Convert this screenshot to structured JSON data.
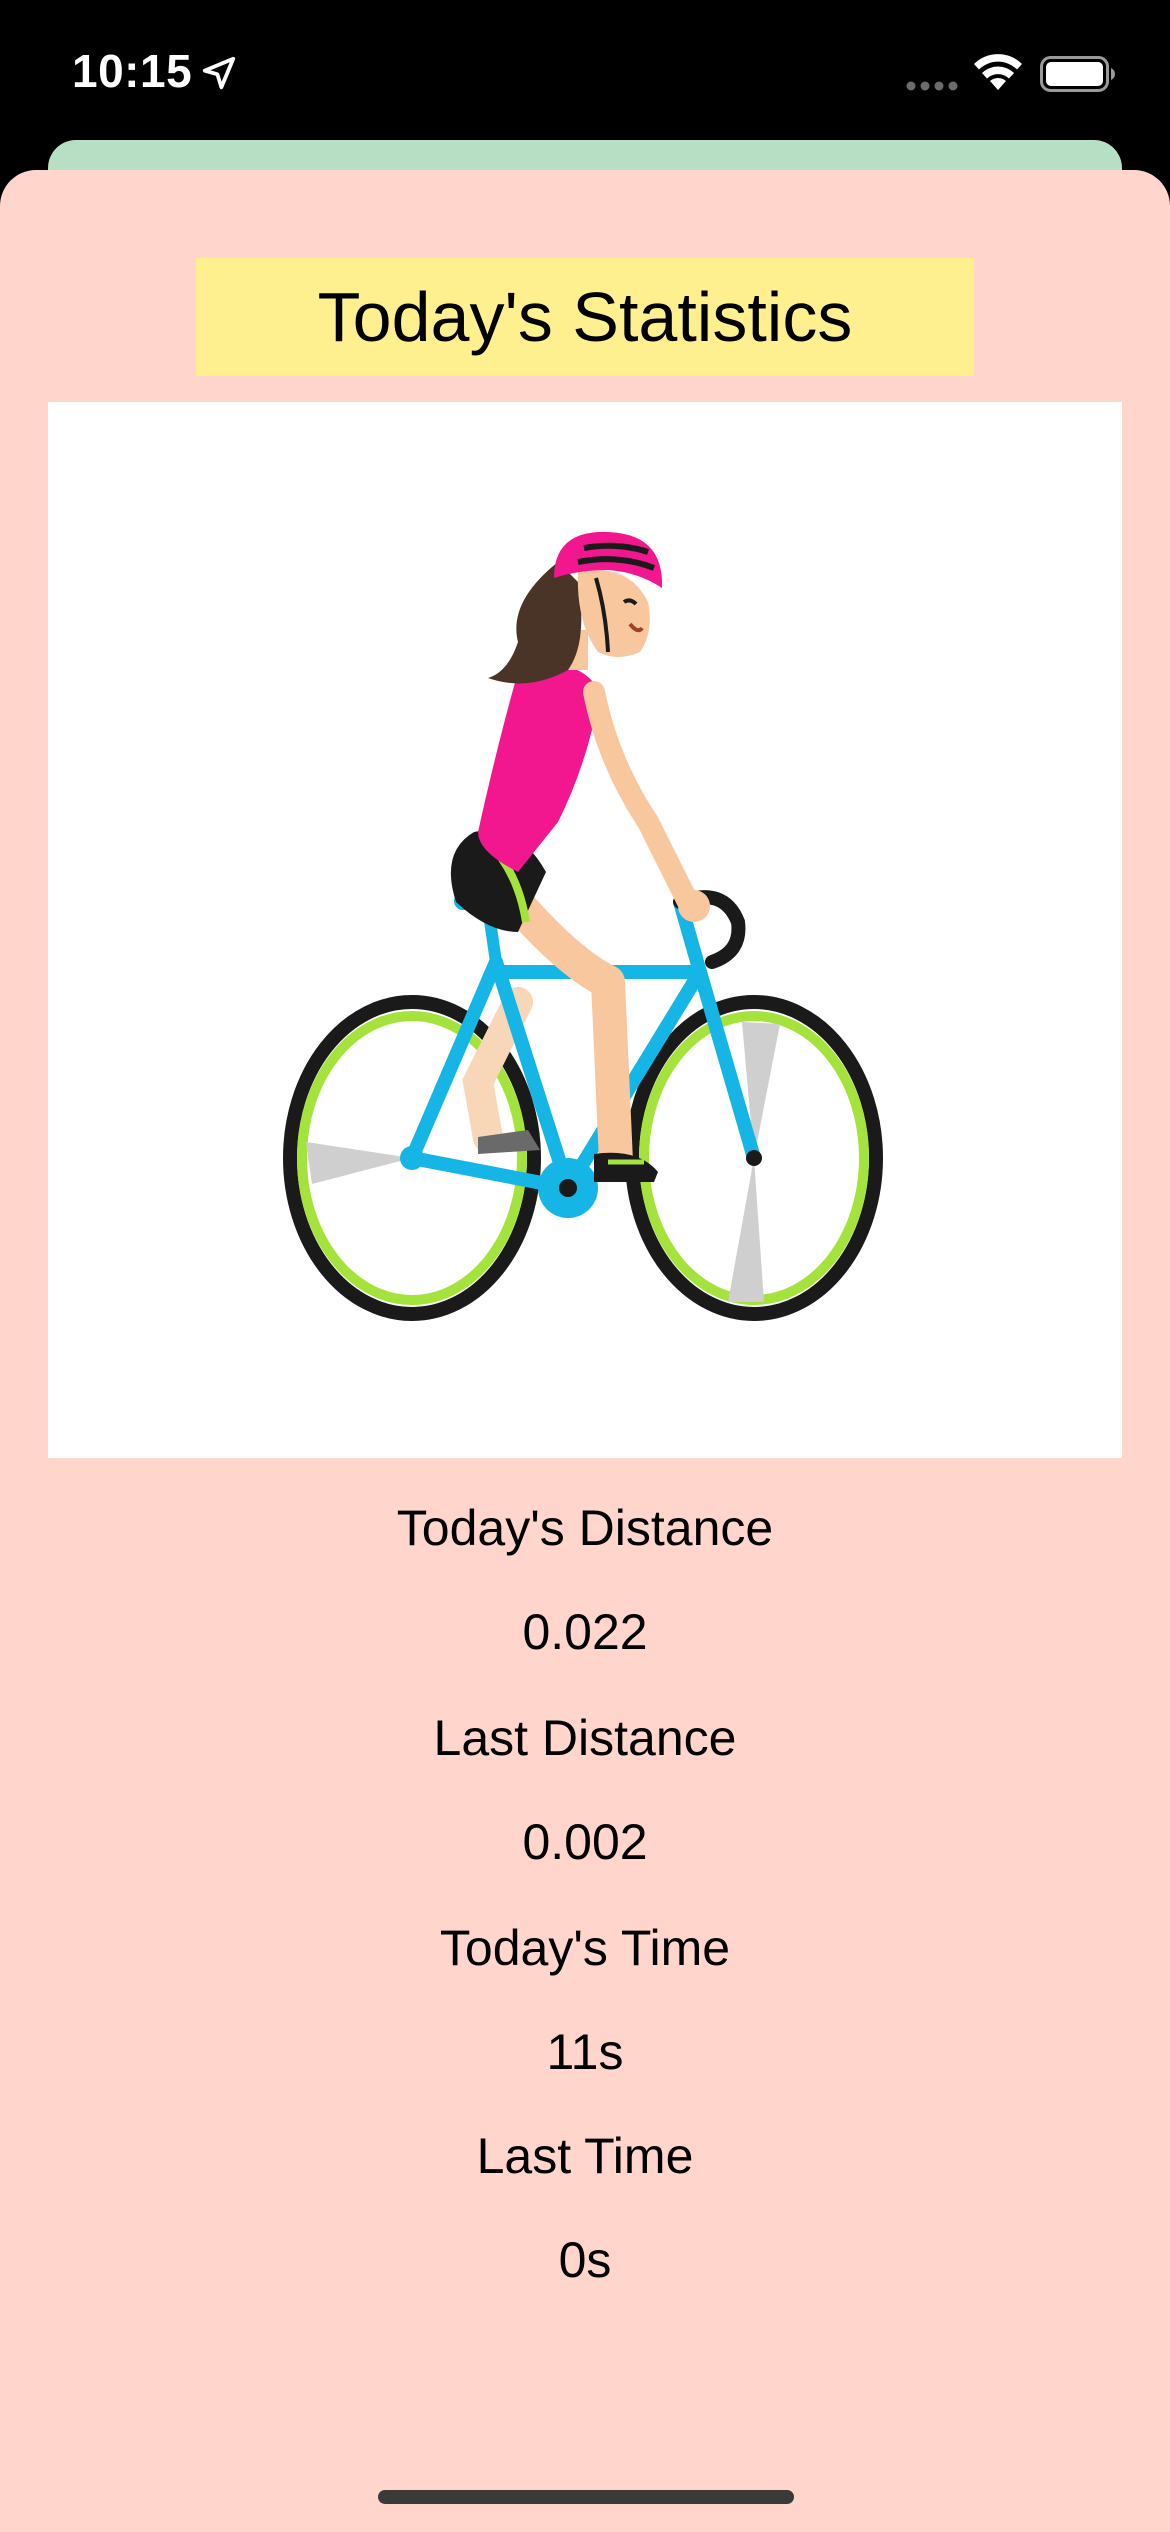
{
  "status_bar": {
    "time": "10:15",
    "icons": [
      "location-arrow-icon",
      "cellular-signal-icon",
      "wifi-icon",
      "battery-icon"
    ]
  },
  "header": {
    "title": "Today's Statistics"
  },
  "illustration": {
    "subject": "cyclist-illustration"
  },
  "stats": {
    "todays_distance_label": "Today's Distance",
    "todays_distance_value": "0.022",
    "last_distance_label": "Last Distance",
    "last_distance_value": "0.002",
    "todays_time_label": "Today's Time",
    "todays_time_value": "11s",
    "last_time_label": "Last Time",
    "last_time_value": "0s"
  },
  "colors": {
    "sheet_background": "#ffd5cc",
    "title_background": "#fff08f",
    "back_sheet": "#b7dfc3",
    "bike_frame": "#15b5e6",
    "tire_accent": "#a4e33c",
    "jersey": "#f2168f"
  }
}
